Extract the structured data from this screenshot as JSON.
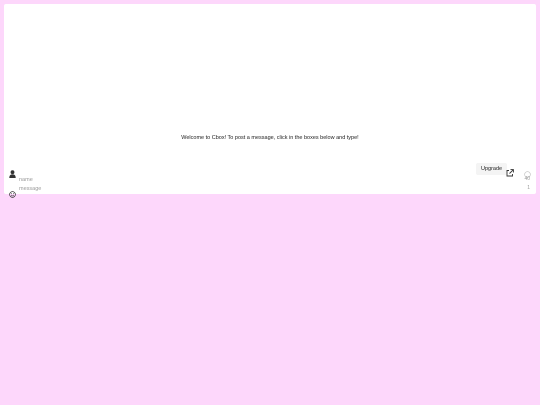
{
  "welcome_text": "Welcome to Cbox! To post a message, click in the boxes below and type!",
  "toolbar": {
    "user_icon": "user-icon",
    "upgrade_label": "Upgrade",
    "popout_icon": "external-link-icon",
    "status_icon": "status-circle-icon"
  },
  "form": {
    "name_placeholder": "name",
    "name_count": "40",
    "message_placeholder": "message",
    "message_count": "1",
    "smiley_icon": "smiley-icon"
  },
  "colors": {
    "page_background": "#fdd7fb",
    "panel_background": "#ffffff"
  }
}
